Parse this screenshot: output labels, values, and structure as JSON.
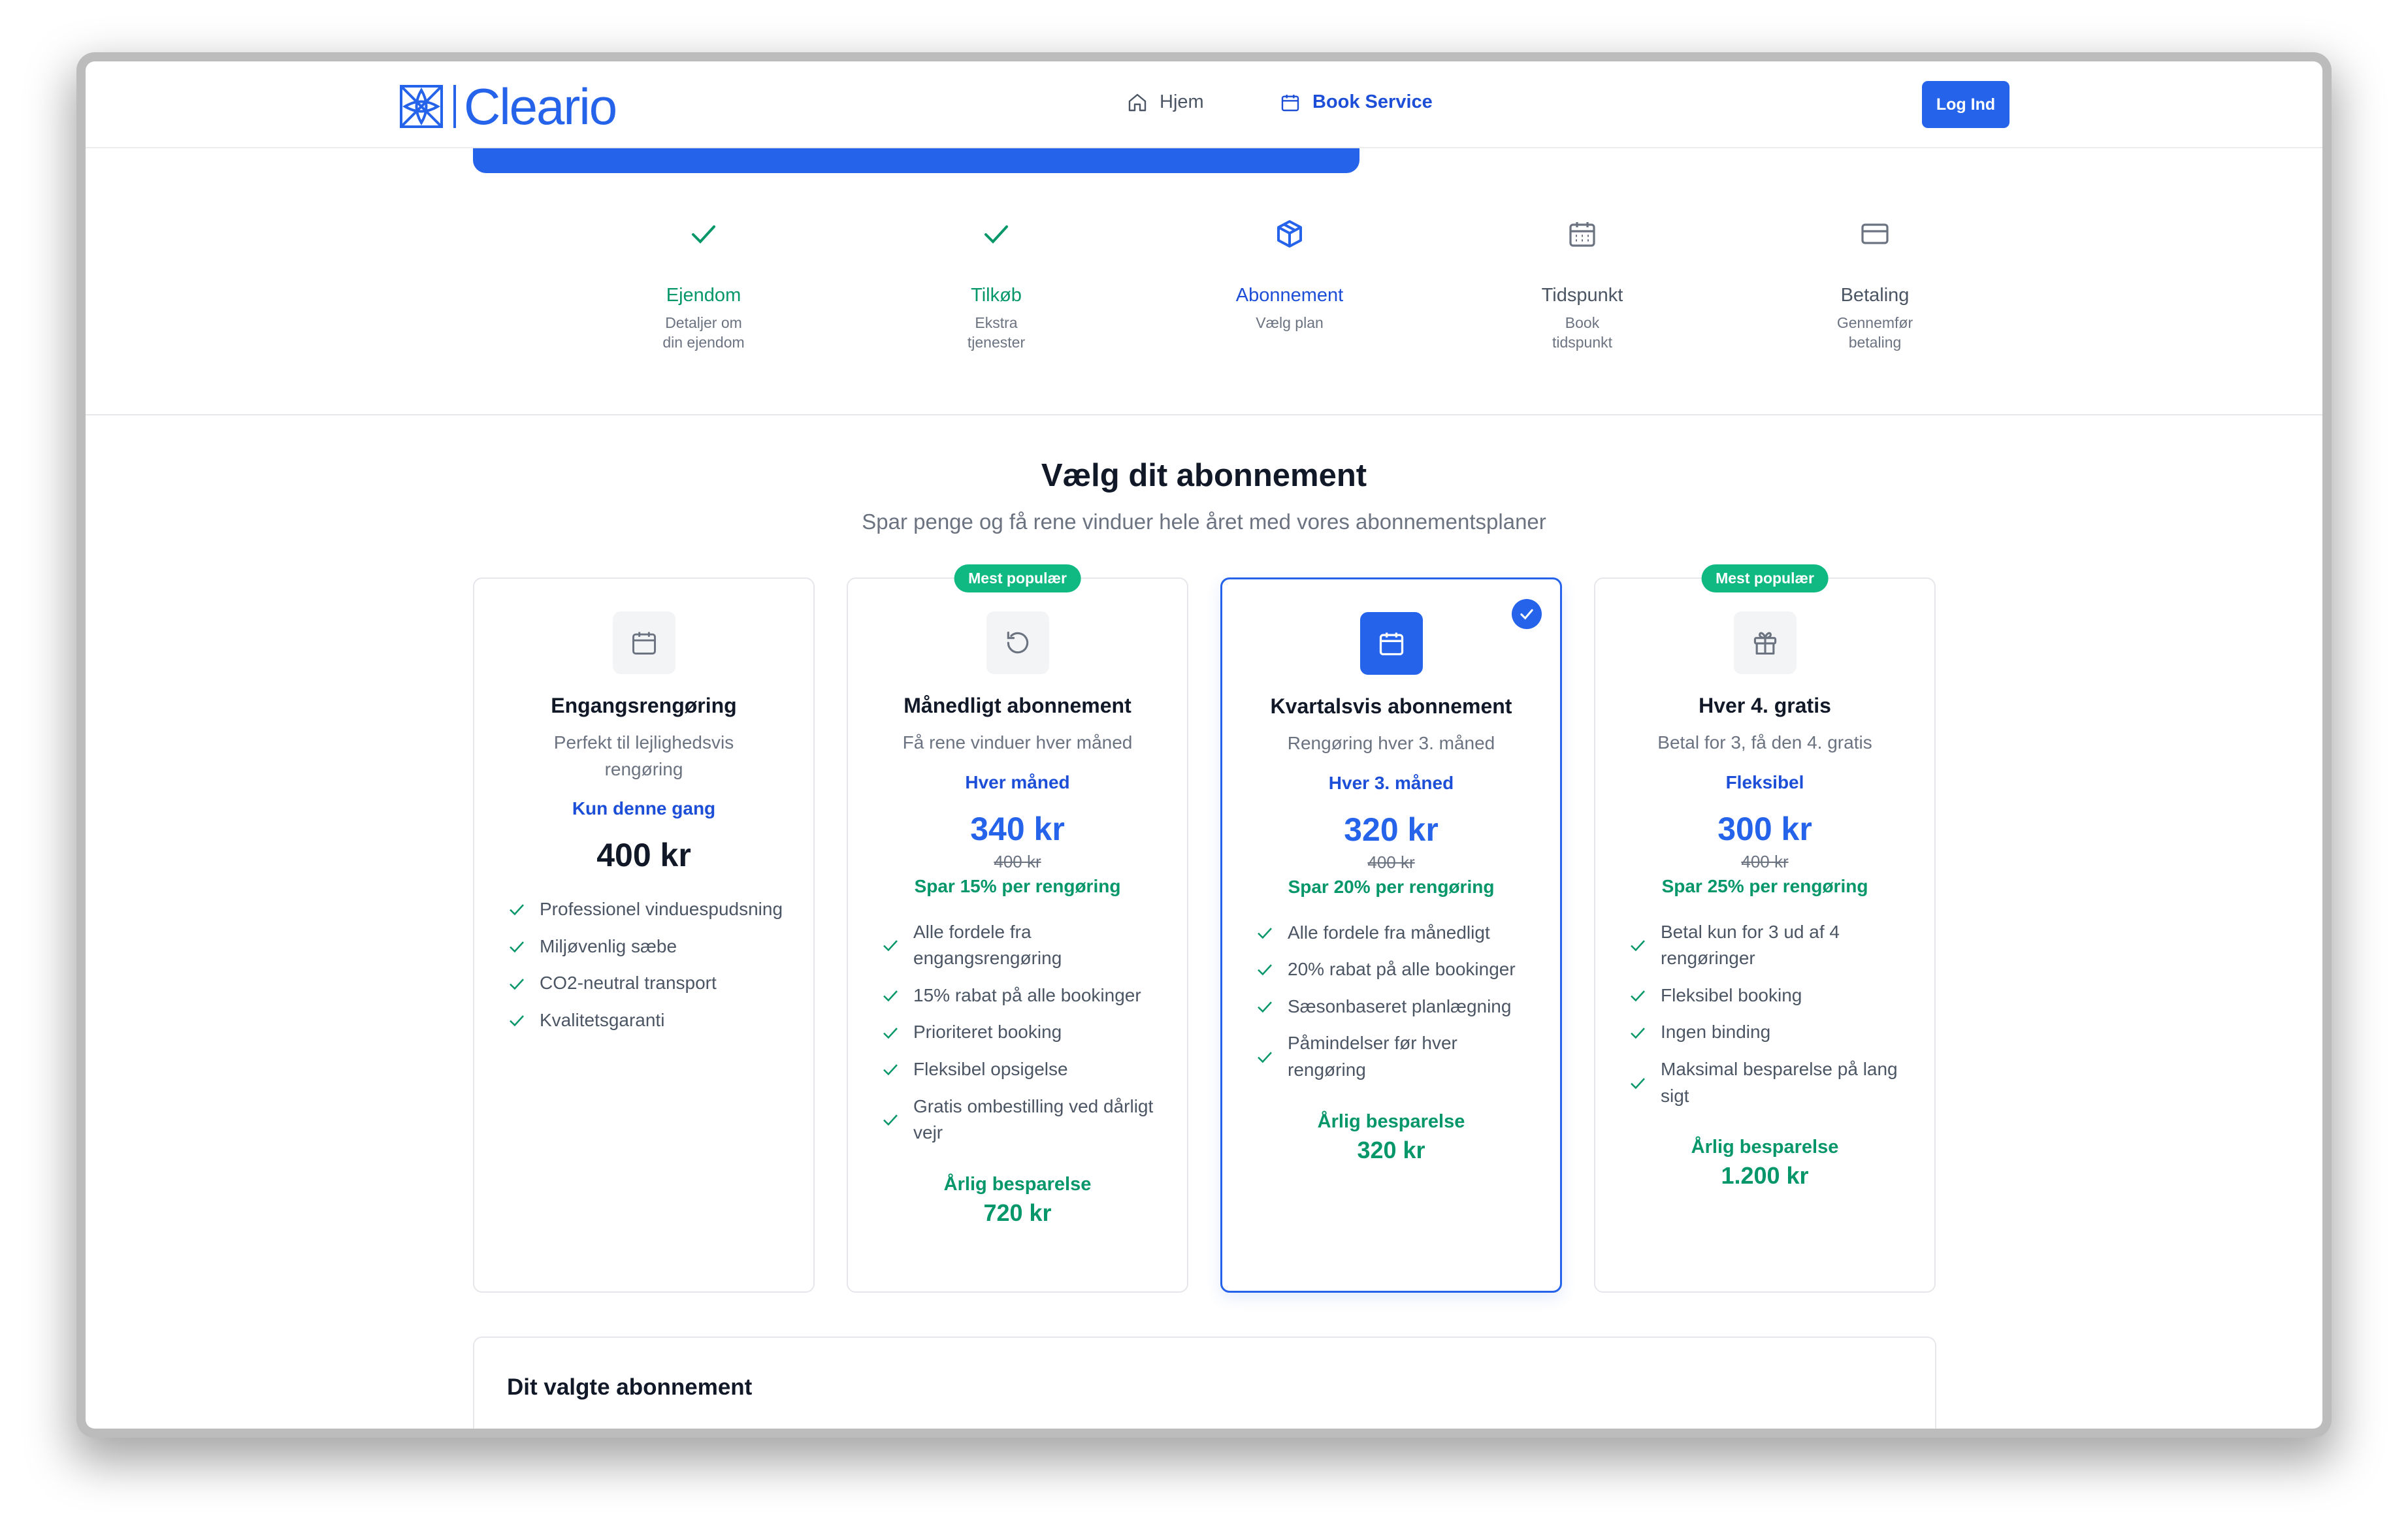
{
  "header": {
    "logo_text": "Cleario",
    "nav": {
      "home": "Hjem",
      "book": "Book Service"
    },
    "login": "Log Ind"
  },
  "progress": {
    "fraction": 0.56
  },
  "steps": [
    {
      "title": "Ejendom",
      "desc": "Detaljer om din ejendom",
      "state": "done"
    },
    {
      "title": "Tilkøb",
      "desc": "Ekstra tjenester",
      "state": "done"
    },
    {
      "title": "Abonnement",
      "desc": "Vælg plan",
      "state": "active"
    },
    {
      "title": "Tidspunkt",
      "desc": "Book tidspunkt",
      "state": "pending"
    },
    {
      "title": "Betaling",
      "desc": "Gennemfør betaling",
      "state": "pending"
    }
  ],
  "main": {
    "title": "Vælg dit abonnement",
    "subtitle": "Spar penge og få rene vinduer hele året med vores abonnementsplaner"
  },
  "plans": [
    {
      "title": "Engangsrengøring",
      "desc": "Perfekt til lejlighedsvis rengøring",
      "freq": "Kun denne gang",
      "price": "400 kr",
      "icon": "calendar-icon",
      "features": [
        "Professionel vinduespudsning",
        "Miljøvenlig sæbe",
        "CO2-neutral transport",
        "Kvalitetsgaranti"
      ]
    },
    {
      "badge": "Mest populær",
      "title": "Månedligt abonnement",
      "desc": "Få rene vinduer hver måned",
      "freq": "Hver måned",
      "price": "340 kr",
      "old_price": "400 kr",
      "saving": "Spar 15% per rengøring",
      "icon": "refresh-icon",
      "features": [
        "Alle fordele fra engangsrengøring",
        "15% rabat på alle bookinger",
        "Prioriteret booking",
        "Fleksibel opsigelse",
        "Gratis ombestilling ved dårligt vejr"
      ],
      "annual_label": "Årlig besparelse",
      "annual_value": "720 kr"
    },
    {
      "selected": true,
      "title": "Kvartalsvis abonnement",
      "desc": "Rengøring hver 3. måned",
      "freq": "Hver 3. måned",
      "price": "320 kr",
      "old_price": "400 kr",
      "saving": "Spar 20% per rengøring",
      "icon": "calendar-icon",
      "features": [
        "Alle fordele fra månedligt",
        "20% rabat på alle bookinger",
        "Sæsonbaseret planlægning",
        "Påmindelser før hver rengøring"
      ],
      "annual_label": "Årlig besparelse",
      "annual_value": "320 kr"
    },
    {
      "badge": "Mest populær",
      "title": "Hver 4. gratis",
      "desc": "Betal for 3, få den 4. gratis",
      "freq": "Fleksibel",
      "price": "300 kr",
      "old_price": "400 kr",
      "saving": "Spar 25% per rengøring",
      "icon": "gift-icon",
      "features": [
        "Betal kun for 3 ud af 4 rengøringer",
        "Fleksibel booking",
        "Ingen binding",
        "Maksimal besparelse på lang sigt"
      ],
      "annual_label": "Årlig besparelse",
      "annual_value": "1.200 kr"
    }
  ],
  "summary": {
    "title": "Dit valgte abonnement"
  },
  "colors": {
    "primary": "#2563eb",
    "success": "#059669",
    "badge": "#10b981"
  }
}
